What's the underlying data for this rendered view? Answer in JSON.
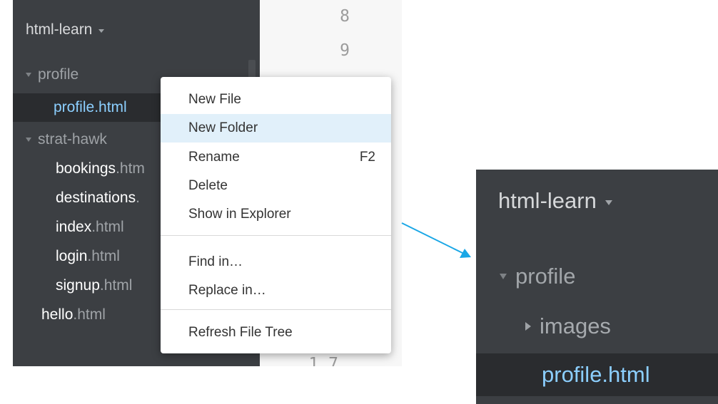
{
  "project": {
    "name": "html-learn"
  },
  "tree": {
    "profile_folder": "profile",
    "profile_file": "profile.html",
    "strathawk_folder": "strat-hawk",
    "files": [
      {
        "name": "bookings",
        "ext": ".htm"
      },
      {
        "name": "destinations",
        "ext": "."
      },
      {
        "name": "index",
        "ext": ".html"
      },
      {
        "name": "login",
        "ext": ".html"
      },
      {
        "name": "signup",
        "ext": ".html"
      }
    ],
    "root_file": {
      "name": "hello",
      "ext": ".html"
    }
  },
  "editor": {
    "line_numbers": [
      "8",
      "9",
      "1 7"
    ]
  },
  "context_menu": {
    "items": [
      {
        "label": "New File",
        "shortcut": ""
      },
      {
        "label": "New Folder",
        "shortcut": ""
      },
      {
        "label": "Rename",
        "shortcut": "F2"
      },
      {
        "label": "Delete",
        "shortcut": ""
      },
      {
        "label": "Show in Explorer",
        "shortcut": ""
      },
      {
        "label": "Find in…",
        "shortcut": ""
      },
      {
        "label": "Replace in…",
        "shortcut": ""
      },
      {
        "label": "Refresh File Tree",
        "shortcut": ""
      }
    ],
    "highlighted_item": "New Folder"
  },
  "zoom_view": {
    "project_name": "html-learn",
    "folder": "profile",
    "subfolder": "images",
    "file": "profile.html"
  },
  "colors": {
    "sidebar_bg": "#3c3f43",
    "selection_bg": "#2a2c2f",
    "selected_text": "#8ccfff",
    "menu_highlight": "#e1f0fa",
    "arrow": "#1aa7e6"
  }
}
